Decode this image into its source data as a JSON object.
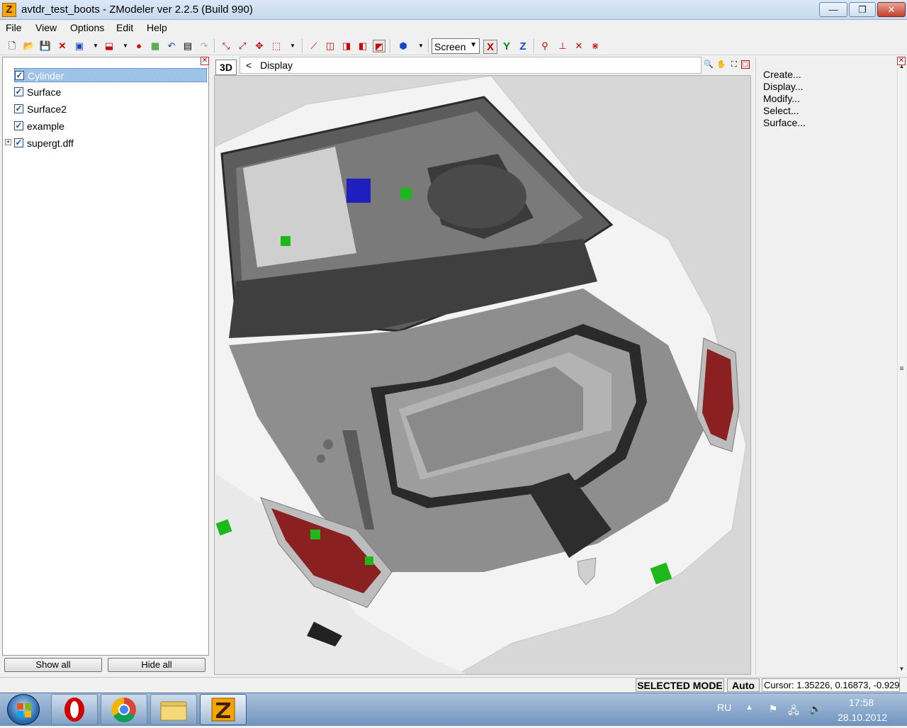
{
  "window": {
    "title": "avtdr_test_boots - ZModeler ver 2.2.5 (Build 990)",
    "app_icon_letter": "Z",
    "controls": {
      "minimize": "—",
      "maximize": "❐",
      "close": "✕"
    }
  },
  "menu": [
    "File",
    "View",
    "Options",
    "Edit",
    "Help"
  ],
  "toolbar": {
    "coordinate_system": "Screen",
    "axes": {
      "x": "X",
      "y": "Y",
      "z": "Z"
    },
    "axis_colors": {
      "x": "#c00000",
      "y": "#0a8a0a",
      "z": "#1747c8"
    }
  },
  "left_panel": {
    "items": [
      {
        "label": "Cylinder",
        "checked": true,
        "selected": true
      },
      {
        "label": "Surface",
        "checked": true,
        "selected": false
      },
      {
        "label": "Surface2",
        "checked": true,
        "selected": false
      },
      {
        "label": "example",
        "checked": true,
        "selected": false
      },
      {
        "label": "supergt.dff",
        "checked": true,
        "selected": false,
        "expandable": true
      }
    ],
    "show_all_label": "Show all",
    "hide_all_label": "Hide all"
  },
  "viewport": {
    "mode_tag": "3D",
    "display_tab_label": "Display",
    "display_tab_arrow": "<"
  },
  "right_panel": {
    "items": [
      "Create...",
      "Display...",
      "Modify...",
      "Select...",
      "Surface..."
    ]
  },
  "statusbar": {
    "mode": "SELECTED MODE",
    "auto": "Auto",
    "cursor": "Cursor: 1.35226, 0.16873, -0.929"
  },
  "taskbar": {
    "language": "RU",
    "time": "17:58",
    "date": "28.10.2012",
    "apps": [
      "opera",
      "chrome",
      "explorer",
      "zmodeler"
    ]
  }
}
